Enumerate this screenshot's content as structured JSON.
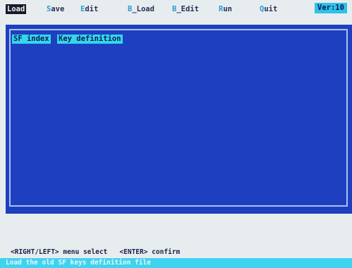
{
  "menu": {
    "items": [
      {
        "hot": "L",
        "rest": "oad",
        "active": true
      },
      {
        "hot": "S",
        "rest": "ave",
        "active": false
      },
      {
        "hot": "E",
        "rest": "dit",
        "active": false
      },
      {
        "hot": "B",
        "rest": "_Load",
        "active": false
      },
      {
        "hot": "B",
        "rest": "_Edit",
        "active": false
      },
      {
        "hot": "R",
        "rest": "un",
        "active": false
      },
      {
        "hot": "Q",
        "rest": "uit",
        "active": false
      }
    ],
    "version": "Ver:10"
  },
  "panel": {
    "col_index": "SF index",
    "col_definition": "Key definition"
  },
  "help": {
    "text": "<RIGHT/LEFT> menu select   <ENTER> confirm"
  },
  "status": {
    "text": "Load the old SF keys definition file"
  },
  "colors": {
    "panel_blue": "#1e3fc0",
    "highlight_cyan": "#33d6ee",
    "hotkey": "#2f9ad0"
  }
}
